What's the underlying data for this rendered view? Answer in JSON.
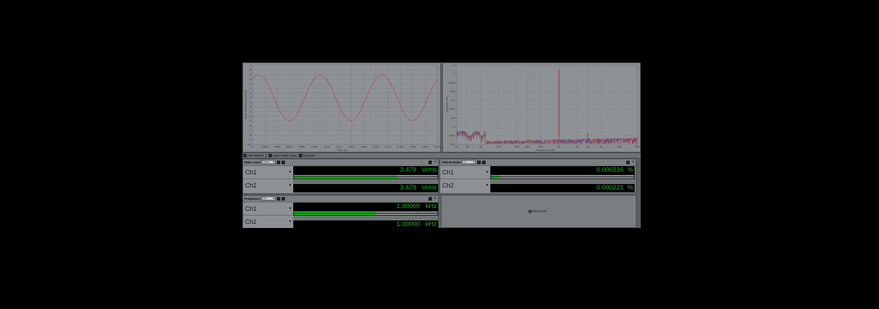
{
  "toolbar": {
    "add_meter_label": "Add Meter",
    "save_meter_data_label": "Save Meter Data",
    "regulate_label": "Regulate"
  },
  "graph_left": {
    "ylabel": "Instantaneous Level (V)",
    "xlabel": "Time (s)",
    "y_ticks": [
      "7",
      "6",
      "5",
      "4",
      "3",
      "2",
      "1",
      "0",
      "-1",
      "-2",
      "-3",
      "-4",
      "-5",
      "-6",
      "-7",
      "-8",
      "-9",
      "-10"
    ],
    "x_ticks": [
      "0",
      "200u",
      "400u",
      "600u",
      "800u",
      "1.0m",
      "1.2m",
      "1.4m",
      "1.6m",
      "1.8m",
      "2.0m",
      "2.2m",
      "2.4m",
      "2.6m",
      "2.8m",
      "3.0m"
    ]
  },
  "graph_right": {
    "ylabel": "Level (Vrms)",
    "xlabel": "Frequency (Hz)",
    "y_ticks": [
      "10",
      "1",
      "100m",
      "10m",
      "1m",
      "100u",
      "10u",
      "1u",
      "100n",
      "10n"
    ],
    "x_ticks": [
      "20",
      "30",
      "50",
      "100",
      "200",
      "300",
      "500",
      "1k",
      "2k",
      "3k",
      "5k",
      "10k",
      "20k"
    ]
  },
  "chart_data": [
    {
      "type": "line",
      "xlabel": "Time (s)",
      "ylabel": "Instantaneous Level (V)",
      "xlim": [
        0,
        0.003
      ],
      "ylim": [
        -10,
        7
      ],
      "series": [
        {
          "frequency_hz": 1000,
          "amplitude": 4.92,
          "values_description": "sine",
          "color": "#b24a5a"
        }
      ]
    },
    {
      "type": "line",
      "xlabel": "Frequency (Hz)",
      "ylabel": "Level (Vrms)",
      "xscale": "log",
      "yscale": "log",
      "xlim": [
        20,
        20000
      ],
      "ylim": [
        1e-08,
        10
      ],
      "peaks": [
        {
          "x": 1000,
          "y": 3.479
        },
        {
          "x": 3000,
          "y": 2e-07
        }
      ],
      "colors": [
        "#a3232f",
        "#3d4aa8"
      ]
    }
  ],
  "meters": {
    "rms": {
      "title": "RMS Level",
      "unit_select": "Vrms",
      "ch1": {
        "label": "Ch1",
        "value": "3.479",
        "unit": "Vrms",
        "bar_fraction": 0.72
      },
      "ch2": {
        "label": "Ch2",
        "value": "3.479",
        "unit": "Vrms",
        "bar_fraction": 0.72
      }
    },
    "thdn": {
      "title": "THD+N Ratio",
      "unit_select": "%",
      "ch1": {
        "label": "Ch1",
        "value": "0.000216",
        "unit": "%",
        "bar_fraction": 0.06
      },
      "ch2": {
        "label": "Ch2",
        "value": "0.000221",
        "unit": "%",
        "bar_fraction": 0.06
      }
    },
    "freq": {
      "title": "Frequency",
      "unit_select": "Hz",
      "ch1": {
        "label": "Ch1",
        "value": "1.00000",
        "unit": "kHz",
        "bar_fraction": 0.57
      },
      "ch2": {
        "label": "Ch2",
        "value": "1.00000",
        "unit": "kHz",
        "bar_fraction": 0.57
      }
    }
  },
  "add_meter_panel": {
    "label": "Add meter..."
  }
}
